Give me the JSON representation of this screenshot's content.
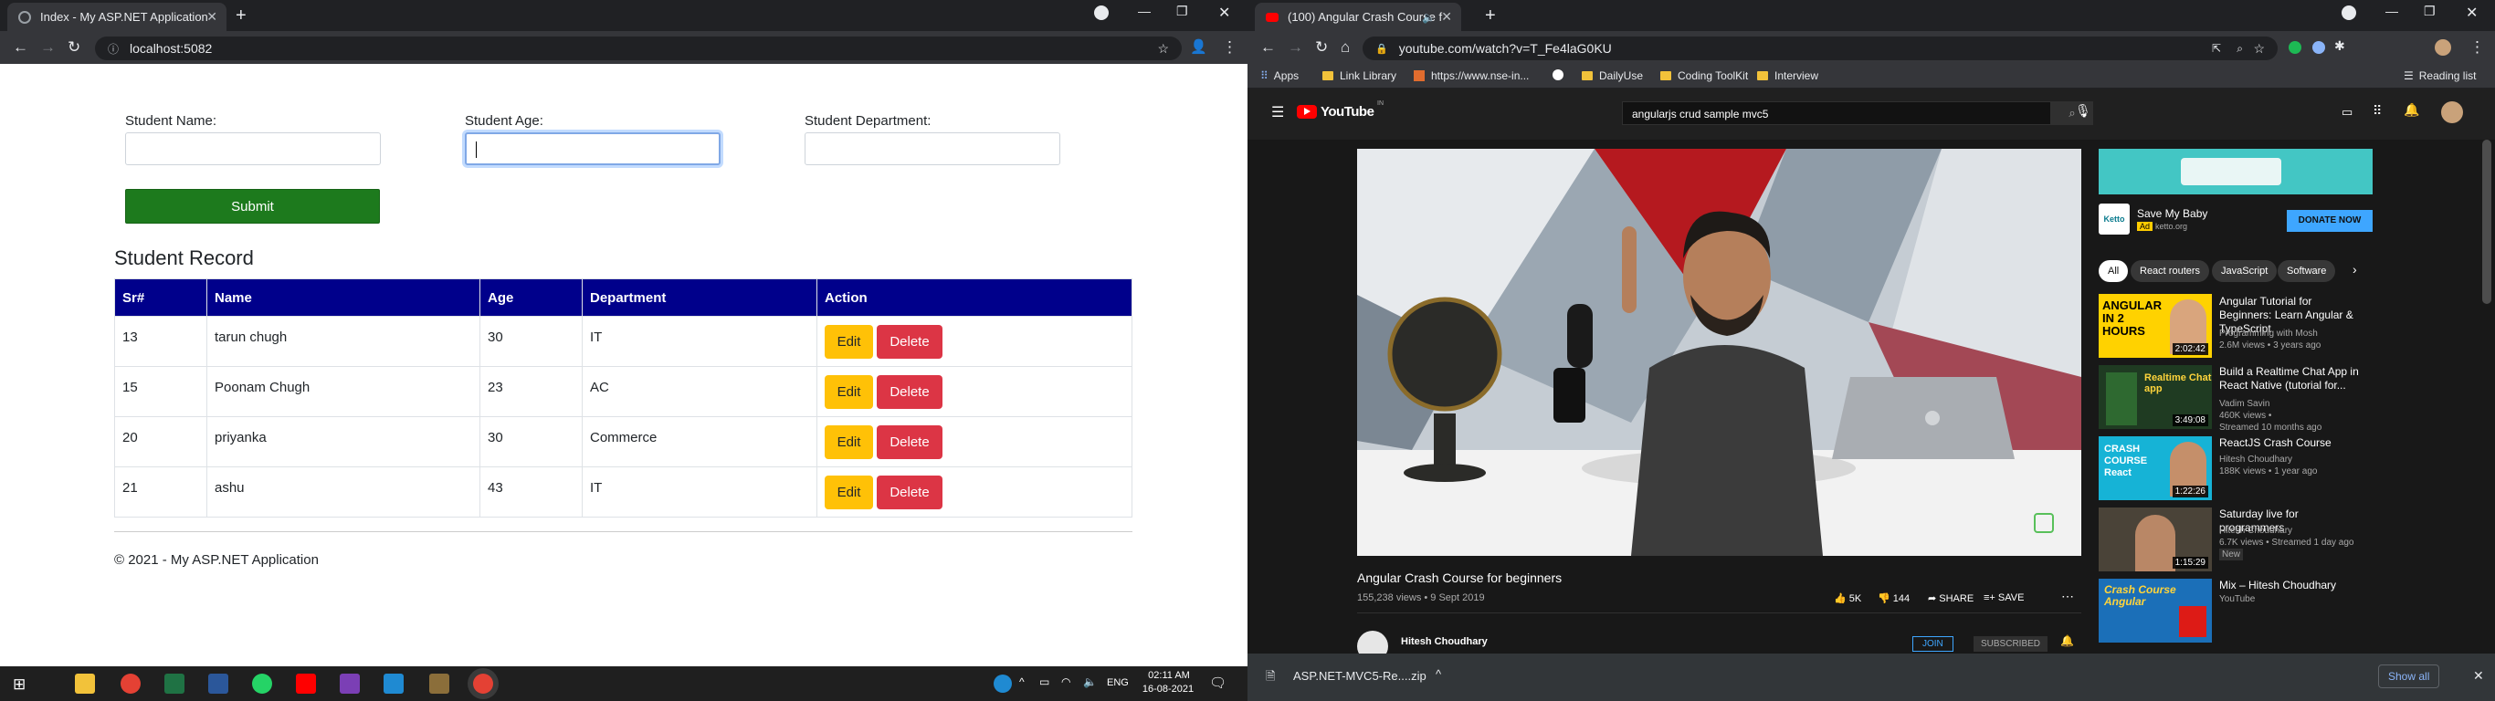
{
  "left_browser": {
    "tab_title": "Index - My ASP.NET Application",
    "address": "localhost:5082",
    "form": {
      "name_label": "Student Name:",
      "age_label": "Student Age:",
      "dept_label": "Student Department:",
      "submit_label": "Submit"
    },
    "record_heading": "Student Record",
    "table": {
      "headers": [
        "Sr#",
        "Name",
        "Age",
        "Department",
        "Action"
      ],
      "rows": [
        {
          "sr": "13",
          "name": "tarun chugh",
          "age": "30",
          "dept": "IT"
        },
        {
          "sr": "15",
          "name": "Poonam Chugh",
          "age": "23",
          "dept": "AC"
        },
        {
          "sr": "20",
          "name": "priyanka",
          "age": "30",
          "dept": "Commerce"
        },
        {
          "sr": "21",
          "name": "ashu",
          "age": "43",
          "dept": "IT"
        }
      ],
      "edit_label": "Edit",
      "delete_label": "Delete"
    },
    "footer": "© 2021 - My ASP.NET Application"
  },
  "right_browser": {
    "tab_title": "(100) Angular Crash Course f",
    "address": "youtube.com/watch?v=T_Fe4laG0KU",
    "bookmarks": {
      "apps": "Apps",
      "link_library": "Link Library",
      "nse": "https://www.nse-in...",
      "daily_use": "DailyUse",
      "coding_toolkit": "Coding ToolKit",
      "interview": "Interview",
      "reading_list": "Reading list"
    },
    "youtube": {
      "logo": "YouTube",
      "logo_sup": "IN",
      "search_value": "angularjs crud sample mvc5",
      "video_title": "Angular Crash Course for beginners",
      "video_meta": "155,238 views • 9 Sept 2019",
      "likes": "5K",
      "dislikes": "144",
      "share": "SHARE",
      "save": "SAVE",
      "channel": "Hitesh Choudhary",
      "join": "JOIN",
      "subscribed": "SUBSCRIBED",
      "ad": {
        "title": "Save My Baby",
        "badge": "Ad",
        "domain": "ketto.org",
        "brand": "Ketto",
        "cta": "DONATE NOW"
      },
      "chips": [
        "All",
        "React routers",
        "JavaScript",
        "Software"
      ],
      "recommendations": [
        {
          "title": "Angular Tutorial for Beginners: Learn Angular & TypeScript",
          "channel": "Programming with Mosh",
          "meta": "2.6M views • 3 years ago",
          "duration": "2:02:42",
          "thumb_text": "ANGULAR IN 2 HOURS"
        },
        {
          "title": "Build a Realtime Chat App in React Native (tutorial for...",
          "channel": "Vadim Savin",
          "meta": "460K views •",
          "meta2": "Streamed 10 months ago",
          "duration": "3:49:08",
          "thumb_text": "Realtime Chat app"
        },
        {
          "title": "ReactJS Crash Course",
          "channel": "Hitesh Choudhary",
          "meta": "188K views • 1 year ago",
          "duration": "1:22:26",
          "thumb_text": "CRASH COURSE React"
        },
        {
          "title": "Saturday live for programmers",
          "channel": "Hitesh Choudhary",
          "meta": "6.7K views • Streamed 1 day ago",
          "badge": "New",
          "duration": "1:15:29"
        },
        {
          "title": "Mix – Hitesh Choudhary",
          "channel": "YouTube",
          "thumb_text": "Crash Course Angular"
        }
      ]
    },
    "download": {
      "file": "ASP.NET-MVC5-Re....zip",
      "show_all": "Show all"
    }
  },
  "taskbar": {
    "lang": "ENG",
    "time": "02:11 AM",
    "date": "16-08-2021"
  },
  "colors": {
    "table_header": "#00008b",
    "submit": "#1d7a1d",
    "edit": "#ffc107",
    "delete": "#dc3545",
    "yt_red": "#ff0000",
    "donate": "#3ea6ff"
  }
}
